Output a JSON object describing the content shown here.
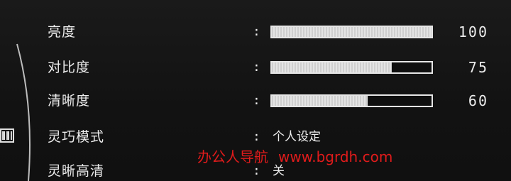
{
  "menu": {
    "items": [
      {
        "label": "亮度",
        "value": "100",
        "level": 1.0
      },
      {
        "label": "对比度",
        "value": "75",
        "level": 0.75
      },
      {
        "label": "清晰度",
        "value": "60",
        "level": 0.6
      },
      {
        "label": "灵巧模式",
        "value": "个人设定"
      },
      {
        "label": "灵晰高清",
        "value": "关"
      }
    ],
    "colon": ":"
  },
  "watermark": {
    "text": "办公人导航",
    "url": "www.bgrdh.com",
    "color": "#e01b1b"
  }
}
